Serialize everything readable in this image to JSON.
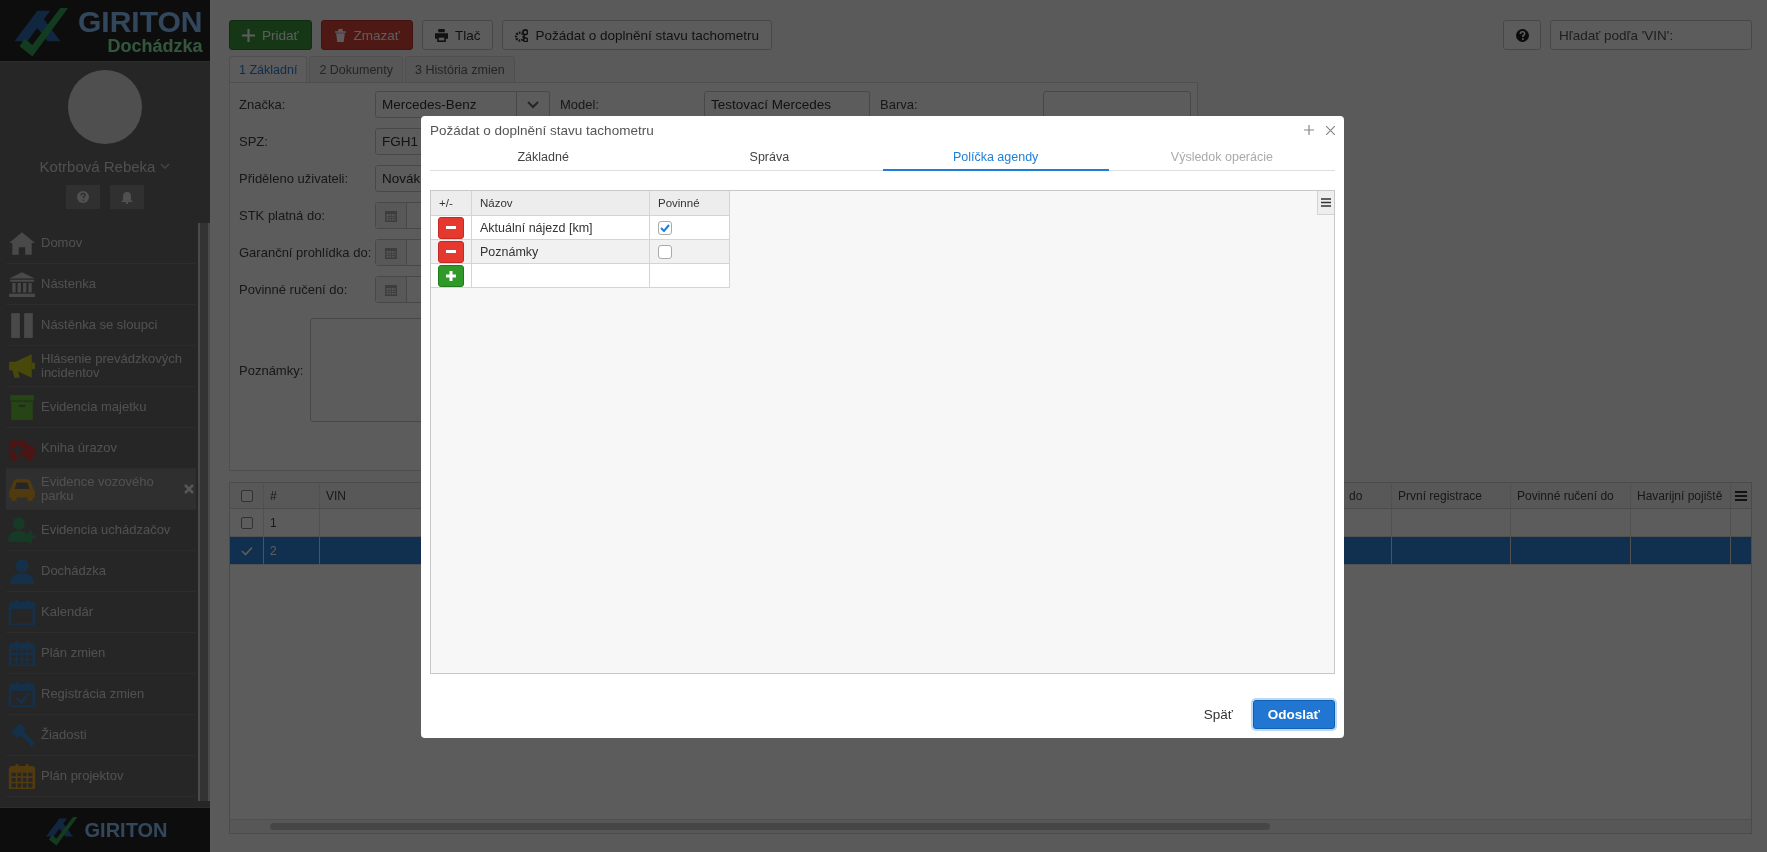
{
  "sidebar": {
    "logo": {
      "brand": "GIRITON",
      "product": "Dochádzka"
    },
    "user": {
      "name": "Kotrbová Rebeka"
    },
    "items": [
      {
        "label": "Domov",
        "selected": false
      },
      {
        "label": "Nástenka",
        "selected": false
      },
      {
        "label": "Nástěnka se sloupci",
        "selected": false
      },
      {
        "label": "Hlásenie prevádzkových incidentov",
        "selected": false
      },
      {
        "label": "Evidencia majetku",
        "selected": false
      },
      {
        "label": "Kniha úrazov",
        "selected": false
      },
      {
        "label": "Evidence vozového parku",
        "selected": true
      },
      {
        "label": "Evidencia uchádzačov",
        "selected": false
      },
      {
        "label": "Dochádzka",
        "selected": false
      },
      {
        "label": "Kalendár",
        "selected": false
      },
      {
        "label": "Plán zmien",
        "selected": false
      },
      {
        "label": "Registrácia zmien",
        "selected": false
      },
      {
        "label": "Žiadosti",
        "selected": false
      },
      {
        "label": "Plán projektov",
        "selected": false
      }
    ],
    "footer_logo": "GIRITON"
  },
  "toolbar": {
    "buttons": [
      {
        "kind": "add",
        "label": "Pridať"
      },
      {
        "kind": "delete",
        "label": "Zmazať"
      },
      {
        "kind": "print",
        "label": "Tlač"
      },
      {
        "kind": "request",
        "label": "Požádat o doplnění stavu tachometru"
      }
    ],
    "search": {
      "placeholder": "Hľadať podľa 'VIN':"
    }
  },
  "record_tabs": [
    {
      "label": "1 Základní",
      "selected": true
    },
    {
      "label": "2 Dokumenty",
      "selected": false
    },
    {
      "label": "3 História zmien",
      "selected": false
    }
  ],
  "form": {
    "rows": [
      [
        {
          "label": "Značka:",
          "kind": "select",
          "value": "Mercedes-Benz"
        },
        {
          "label": "Model:",
          "kind": "text",
          "value": "Testovací Mercedes"
        },
        {
          "label": "Barva:",
          "kind": "text"
        }
      ],
      [
        {
          "label": "SPZ:",
          "kind": "text",
          "value": "FGH1"
        }
      ],
      [
        {
          "label": "Přiděleno uživateli:",
          "kind": "text",
          "value": "Novák"
        }
      ],
      [
        {
          "label": "STK platná do:",
          "kind": "date"
        }
      ],
      [
        {
          "label": "Garanční prohlídka do:",
          "kind": "date"
        }
      ],
      [
        {
          "label": "Povinné ručení do:",
          "kind": "date"
        }
      ],
      [
        {
          "label": "Poznámky:",
          "kind": "textarea"
        }
      ]
    ]
  },
  "vehicle_table": {
    "all_selected": false,
    "columns": [
      {
        "kind": "check"
      },
      {
        "kind": "text",
        "label": "#"
      },
      {
        "kind": "text",
        "label": "VIN"
      },
      {
        "kind": "text",
        "label": "do"
      },
      {
        "kind": "text",
        "label": "První registrace"
      },
      {
        "kind": "text",
        "label": "Povinné ručení do"
      },
      {
        "kind": "text",
        "label": "Havarijní pojiště"
      }
    ],
    "rows": [
      {
        "number": "1",
        "selected": false
      },
      {
        "number": "2",
        "selected": true
      }
    ]
  },
  "dialog": {
    "title": "Požádat o doplnění stavu tachometru",
    "steps": [
      {
        "label": "Základné",
        "selected": false,
        "disabled": false
      },
      {
        "label": "Správa",
        "selected": false,
        "disabled": false
      },
      {
        "label": "Políčka agendy",
        "selected": true,
        "disabled": false
      },
      {
        "label": "Výsledok operácie",
        "selected": false,
        "disabled": true
      }
    ],
    "fields_table": {
      "columns": [
        "+/-",
        "Názov",
        "Povinné"
      ],
      "rows": [
        {
          "kind": "remove",
          "name": "Aktuální nájezd [km]",
          "required": true
        },
        {
          "kind": "remove",
          "name": "Poznámky",
          "required": false
        },
        {
          "kind": "add"
        }
      ]
    },
    "buttons": [
      {
        "kind": "back",
        "label": "Späť"
      },
      {
        "kind": "submit",
        "label": "Odoslať"
      }
    ]
  }
}
